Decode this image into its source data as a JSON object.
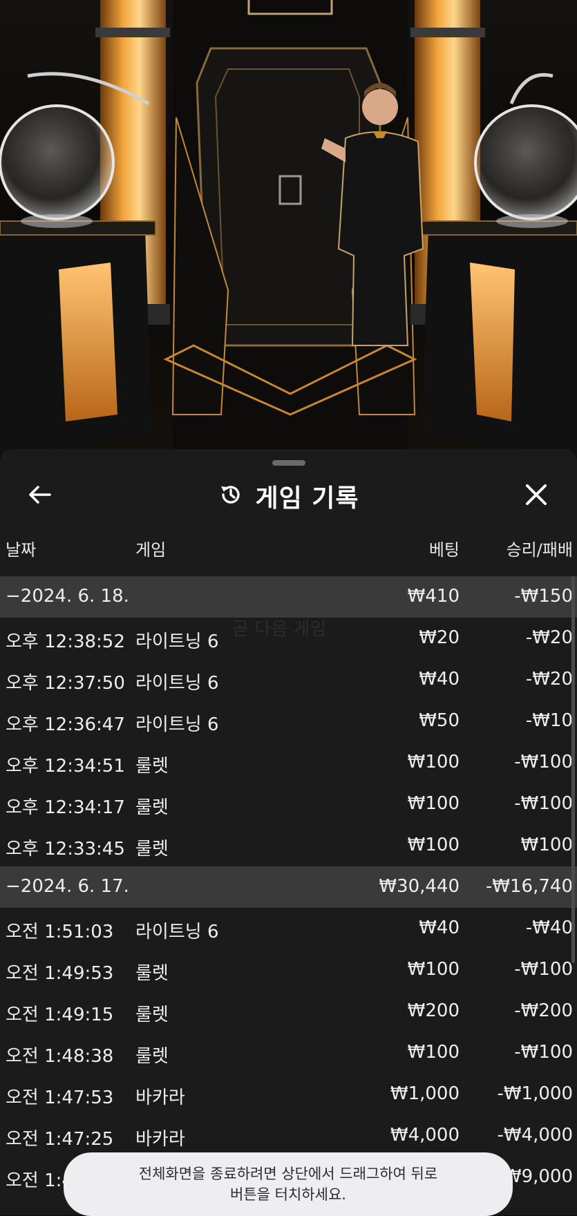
{
  "header": {
    "title": "게임 기록",
    "icons": {
      "back": "arrow-left-icon",
      "history": "history-icon",
      "close": "close-icon"
    }
  },
  "columns": {
    "date": "날짜",
    "game": "게임",
    "bet": "베팅",
    "result": "승리/패배"
  },
  "watermark": "곧 다음 게임",
  "rows": [
    {
      "type": "group",
      "date": "−2024. 6. 18.",
      "game": "",
      "bet": "₩410",
      "result": "-₩150"
    },
    {
      "type": "entry",
      "date": "오후 12:38:52",
      "game": "라이트닝 6",
      "bet": "₩20",
      "result": "-₩20"
    },
    {
      "type": "entry",
      "date": "오후 12:37:50",
      "game": "라이트닝 6",
      "bet": "₩40",
      "result": "-₩20"
    },
    {
      "type": "entry",
      "date": "오후 12:36:47",
      "game": "라이트닝 6",
      "bet": "₩50",
      "result": "-₩10"
    },
    {
      "type": "entry",
      "date": "오후 12:34:51",
      "game": "룰렛",
      "bet": "₩100",
      "result": "-₩100"
    },
    {
      "type": "entry",
      "date": "오후 12:34:17",
      "game": "룰렛",
      "bet": "₩100",
      "result": "-₩100"
    },
    {
      "type": "entry",
      "date": "오후 12:33:45",
      "game": "룰렛",
      "bet": "₩100",
      "result": "₩100"
    },
    {
      "type": "group",
      "date": "−2024. 6. 17.",
      "game": "",
      "bet": "₩30,440",
      "result": "-₩16,740"
    },
    {
      "type": "entry",
      "date": "오전 1:51:03",
      "game": "라이트닝 6",
      "bet": "₩40",
      "result": "-₩40"
    },
    {
      "type": "entry",
      "date": "오전 1:49:53",
      "game": "룰렛",
      "bet": "₩100",
      "result": "-₩100"
    },
    {
      "type": "entry",
      "date": "오전 1:49:15",
      "game": "룰렛",
      "bet": "₩200",
      "result": "-₩200"
    },
    {
      "type": "entry",
      "date": "오전 1:48:38",
      "game": "룰렛",
      "bet": "₩100",
      "result": "-₩100"
    },
    {
      "type": "entry",
      "date": "오전 1:47:53",
      "game": "바카라",
      "bet": "₩1,000",
      "result": "-₩1,000"
    },
    {
      "type": "entry",
      "date": "오전 1:47:25",
      "game": "바카라",
      "bet": "₩4,000",
      "result": "-₩4,000"
    },
    {
      "type": "entry",
      "date": "오전 1:4",
      "game": "",
      "bet": "",
      "result": "₩9,000"
    }
  ],
  "toast": {
    "line1": "전체화면을 종료하려면 상단에서 드래그하여 뒤로",
    "line2": "버튼을 터치하세요."
  },
  "colors": {
    "sheet": "#1b1b1b",
    "group_row": "#3a3a3a",
    "gold": "#c98a2c",
    "toast": "#eeeef0"
  }
}
